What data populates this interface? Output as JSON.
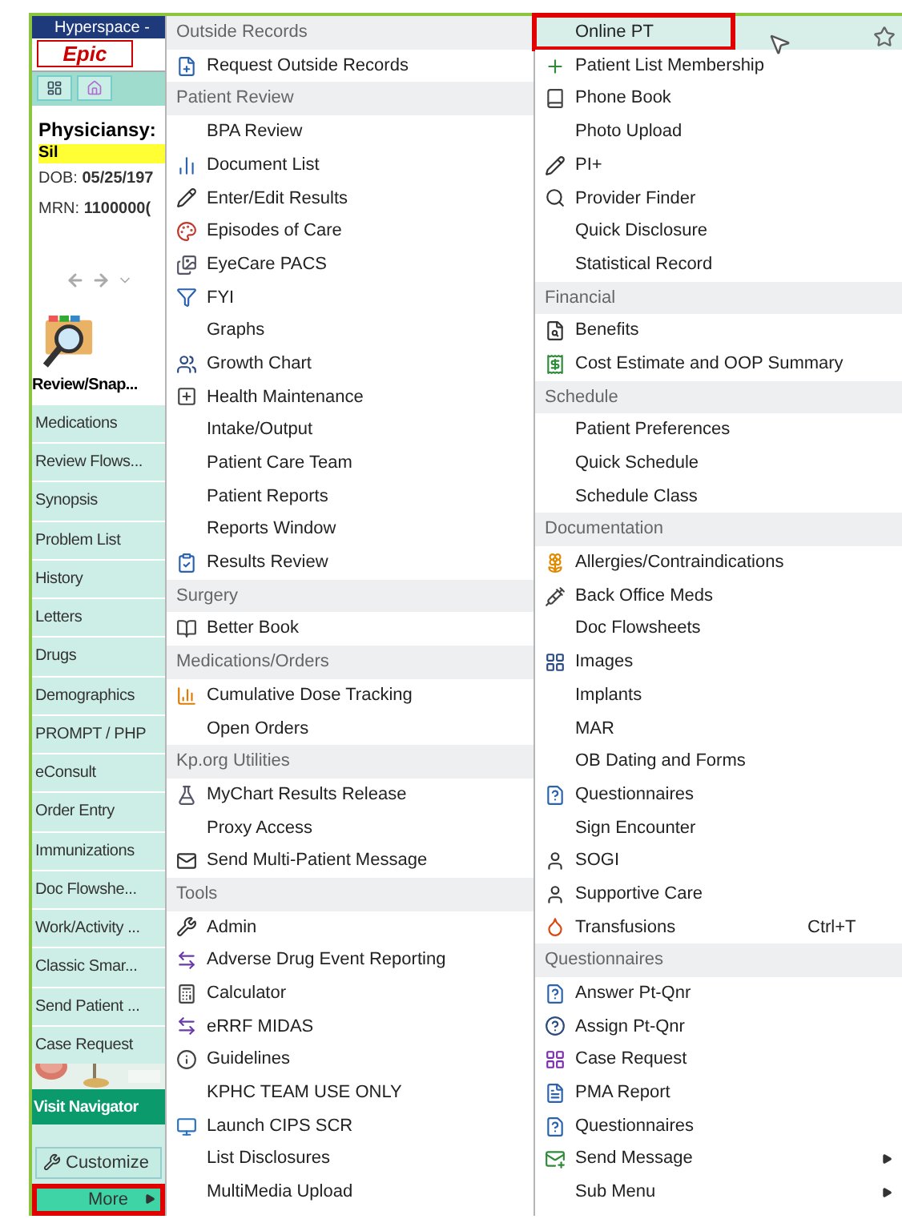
{
  "sidebar": {
    "window_title": "Hyperspace -",
    "logo": "Epic",
    "patient": {
      "name": "Physiciansy:",
      "alert": "Sil",
      "dob_label": "DOB:",
      "dob": "05/25/197",
      "mrn_label": "MRN:",
      "mrn": "1100000("
    },
    "activity_title": "Review/Snap...",
    "items": [
      "Medications",
      "Review Flows...",
      "Synopsis",
      "Problem List",
      "History",
      "Letters",
      "Drugs",
      "Demographics",
      "PROMPT / PHP",
      "eConsult",
      "Order Entry",
      "Immunizations",
      "Doc Flowshe...",
      "Work/Activity ...",
      "Classic Smar...",
      "Send Patient ...",
      "Case Request"
    ],
    "visit_navigator": "Visit Navigator",
    "customize": "Customize",
    "more": {
      "label": "More",
      "outlined": true
    }
  },
  "menu_columns": [
    [
      {
        "kind": "header",
        "label": "Outside Records"
      },
      {
        "kind": "item",
        "label": "Request Outside Records"
      },
      {
        "kind": "header",
        "label": "Patient Review"
      },
      {
        "kind": "item",
        "label": "BPA Review"
      },
      {
        "kind": "item",
        "label": "Document List"
      },
      {
        "kind": "item",
        "label": "Enter/Edit Results"
      },
      {
        "kind": "item",
        "label": "Episodes of Care"
      },
      {
        "kind": "item",
        "label": "EyeCare PACS"
      },
      {
        "kind": "item",
        "label": "FYI"
      },
      {
        "kind": "item",
        "label": "Graphs"
      },
      {
        "kind": "item",
        "label": "Growth Chart"
      },
      {
        "kind": "item",
        "label": "Health Maintenance"
      },
      {
        "kind": "item",
        "label": "Intake/Output"
      },
      {
        "kind": "item",
        "label": "Patient Care Team"
      },
      {
        "kind": "item",
        "label": "Patient Reports"
      },
      {
        "kind": "item",
        "label": "Reports Window"
      },
      {
        "kind": "item",
        "label": "Results Review"
      },
      {
        "kind": "header",
        "label": "Surgery"
      },
      {
        "kind": "item",
        "label": "Better Book"
      },
      {
        "kind": "header",
        "label": "Medications/Orders"
      },
      {
        "kind": "item",
        "label": "Cumulative Dose Tracking"
      },
      {
        "kind": "item",
        "label": "Open Orders"
      },
      {
        "kind": "header",
        "label": "Kp.org Utilities"
      },
      {
        "kind": "item",
        "label": "MyChart Results Release"
      },
      {
        "kind": "item",
        "label": "Proxy Access"
      },
      {
        "kind": "item",
        "label": "Send Multi-Patient Message"
      },
      {
        "kind": "header",
        "label": "Tools"
      },
      {
        "kind": "item",
        "label": "Admin"
      },
      {
        "kind": "item",
        "label": "Adverse Drug Event Reporting"
      },
      {
        "kind": "item",
        "label": "Calculator"
      },
      {
        "kind": "item",
        "label": "eRRF MIDAS"
      },
      {
        "kind": "item",
        "label": "Guidelines"
      },
      {
        "kind": "item",
        "label": "KPHC TEAM USE ONLY"
      },
      {
        "kind": "item",
        "label": "Launch CIPS SCR"
      },
      {
        "kind": "item",
        "label": "List Disclosures"
      },
      {
        "kind": "item",
        "label": "MultiMedia Upload"
      }
    ],
    [
      {
        "kind": "item",
        "label": "Online PT",
        "selected": true,
        "outlined": true
      },
      {
        "kind": "item",
        "label": "Patient List Membership"
      },
      {
        "kind": "item",
        "label": "Phone Book"
      },
      {
        "kind": "item",
        "label": "Photo Upload"
      },
      {
        "kind": "item",
        "label": "PI+"
      },
      {
        "kind": "item",
        "label": "Provider Finder"
      },
      {
        "kind": "item",
        "label": "Quick Disclosure"
      },
      {
        "kind": "item",
        "label": "Statistical Record"
      },
      {
        "kind": "header",
        "label": "Financial"
      },
      {
        "kind": "item",
        "label": "Benefits"
      },
      {
        "kind": "item",
        "label": "Cost Estimate and OOP Summary"
      },
      {
        "kind": "header",
        "label": "Schedule"
      },
      {
        "kind": "item",
        "label": "Patient Preferences"
      },
      {
        "kind": "item",
        "label": "Quick Schedule"
      },
      {
        "kind": "item",
        "label": "Schedule Class"
      },
      {
        "kind": "header",
        "label": "Documentation"
      },
      {
        "kind": "item",
        "label": "Allergies/Contraindications"
      },
      {
        "kind": "item",
        "label": "Back Office Meds"
      },
      {
        "kind": "item",
        "label": "Doc Flowsheets"
      },
      {
        "kind": "item",
        "label": "Images"
      },
      {
        "kind": "item",
        "label": "Implants"
      },
      {
        "kind": "item",
        "label": "MAR"
      },
      {
        "kind": "item",
        "label": "OB Dating and Forms"
      },
      {
        "kind": "item",
        "label": "Questionnaires"
      },
      {
        "kind": "item",
        "label": "Sign Encounter"
      },
      {
        "kind": "item",
        "label": "SOGI"
      },
      {
        "kind": "item",
        "label": "Supportive Care"
      },
      {
        "kind": "item",
        "label": "Transfusions",
        "shortcut": "Ctrl+T"
      },
      {
        "kind": "header",
        "label": "Questionnaires"
      },
      {
        "kind": "item",
        "label": "Answer Pt-Qnr"
      },
      {
        "kind": "item",
        "label": "Assign Pt-Qnr"
      },
      {
        "kind": "item",
        "label": "Case Request"
      },
      {
        "kind": "item",
        "label": "PMA Report"
      },
      {
        "kind": "item",
        "label": "Questionnaires"
      },
      {
        "kind": "item",
        "label": "Send Message",
        "submenu": true
      },
      {
        "kind": "item",
        "label": "Sub Menu",
        "submenu": true
      }
    ]
  ]
}
